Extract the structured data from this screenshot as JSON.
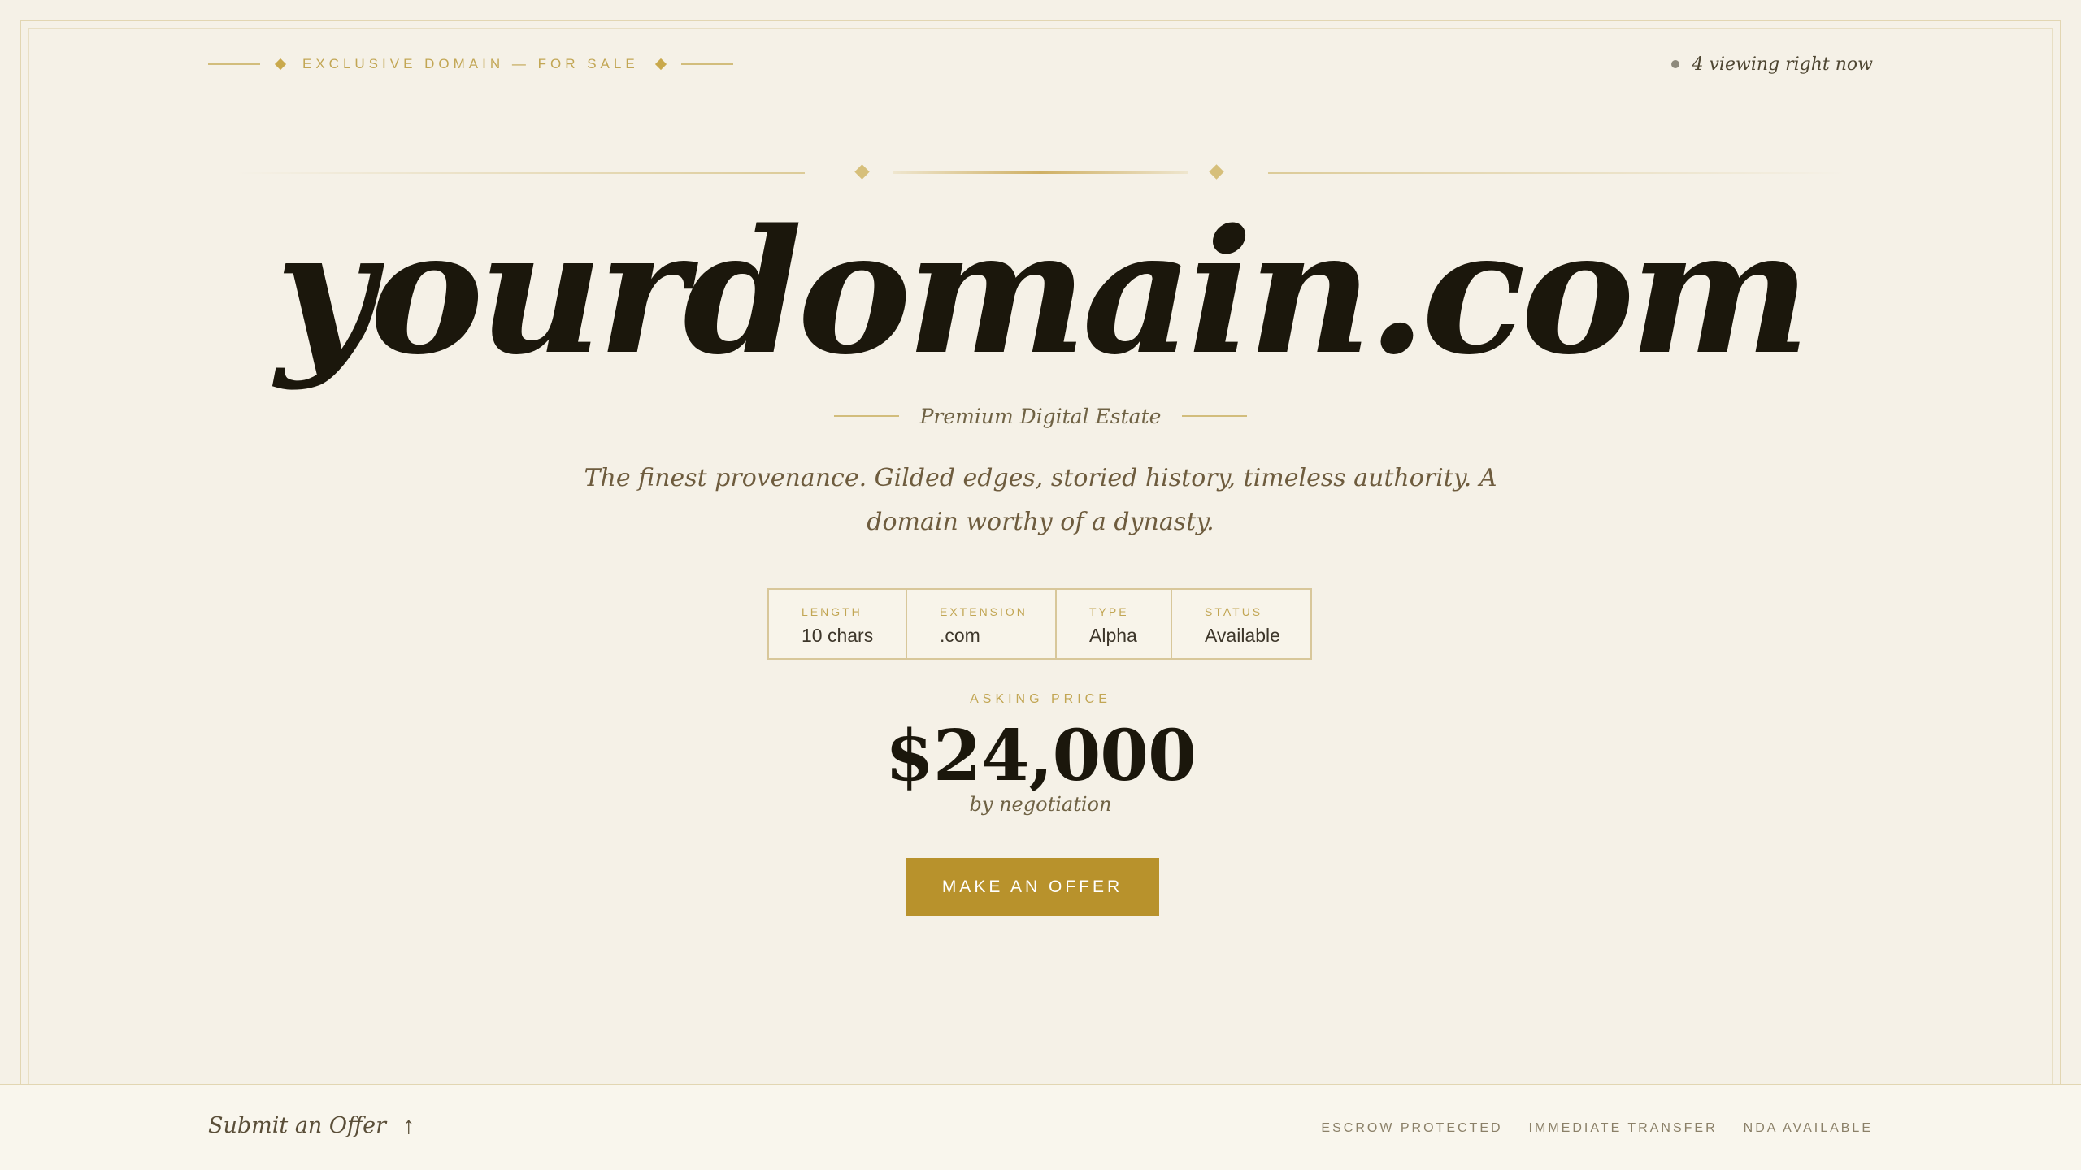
{
  "header": {
    "eyebrow": "EXCLUSIVE DOMAIN — FOR SALE",
    "viewing": "4 viewing right now"
  },
  "hero": {
    "domain": "yourdomain.com",
    "subtitle": "Premium Digital Estate",
    "tagline": "The finest provenance. Gilded edges, storied history, timeless authority. A domain worthy of a dynasty."
  },
  "stats": [
    {
      "label": "LENGTH",
      "value": "10 chars"
    },
    {
      "label": "EXTENSION",
      "value": ".com"
    },
    {
      "label": "TYPE",
      "value": "Alpha"
    },
    {
      "label": "STATUS",
      "value": "Available"
    }
  ],
  "pricing": {
    "label": "ASKING PRICE",
    "price": "$24,000",
    "note": "by negotiation"
  },
  "cta": {
    "label": "MAKE AN OFFER"
  },
  "footer": {
    "offer_link": "Submit an Offer",
    "arrow_glyph": "↑",
    "badges": [
      "ESCROW PROTECTED",
      "IMMEDIATE TRANSFER",
      "NDA AVAILABLE"
    ]
  },
  "colors": {
    "background": "#f5f1e7",
    "accent_gold": "#b8922c",
    "ink": "#1b170c",
    "live_dot": "#8e8a7c"
  },
  "icons": {
    "ornament": "diamond-icon",
    "live_indicator": "dot-icon",
    "offer_arrow": "arrow-up-icon"
  }
}
